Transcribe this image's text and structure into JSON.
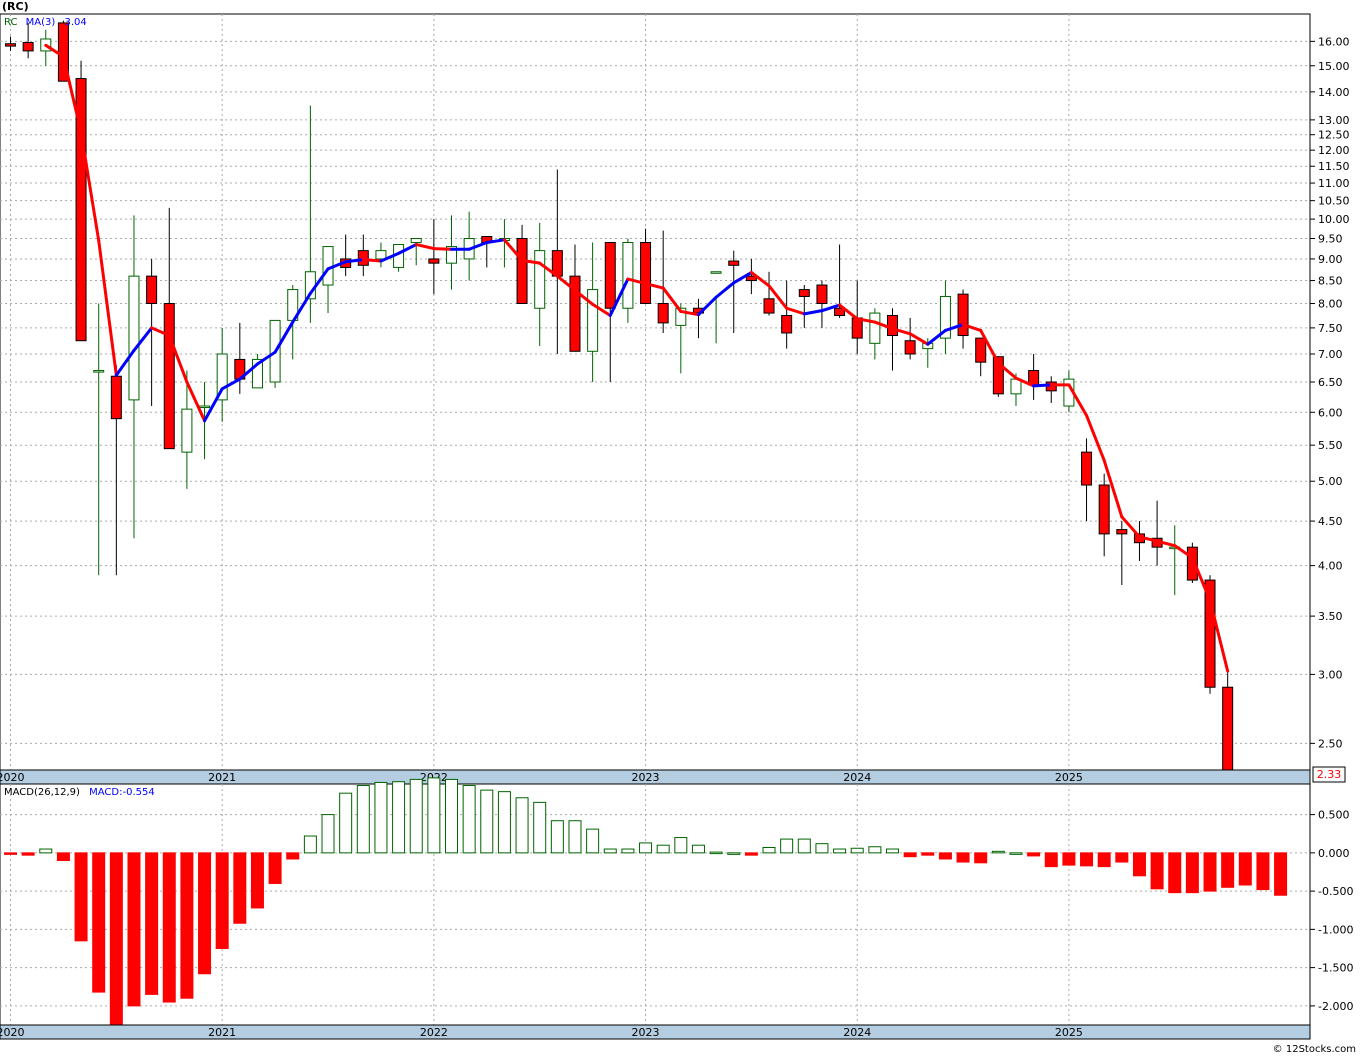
{
  "header": {
    "symbol_title": "(RC)",
    "price_legend_symbol": "RC",
    "price_legend_ma": "MA(3)",
    "price_legend_ma_value": "3.04",
    "macd_legend_name": "MACD(26,12,9)",
    "macd_legend_value": "MACD:-0.554",
    "last_price_badge": "2.33",
    "credit": "© 12Stocks.com"
  },
  "colors": {
    "up": "#006400",
    "down": "#ff0000",
    "ma_up": "#0000ff",
    "ma_down": "#ff0000",
    "axis_band": "#b4cde0",
    "grid": "#aaaaaa",
    "border": "#000000"
  },
  "chart_data": [
    {
      "type": "candlestick",
      "x_labels": [
        "2020",
        "2021",
        "2022",
        "2023",
        "2024",
        "2025"
      ],
      "y_scale": "log",
      "y_ticks": [
        "2.50",
        "3.00",
        "3.50",
        "4.00",
        "4.50",
        "5.00",
        "5.50",
        "6.00",
        "6.50",
        "7.00",
        "7.50",
        "8.00",
        "8.50",
        "9.00",
        "9.50",
        "10.00",
        "10.50",
        "11.00",
        "11.50",
        "12.00",
        "12.50",
        "13.00",
        "14.00",
        "15.00",
        "16.00"
      ],
      "ylim": [
        2.33,
        17.2
      ],
      "grid": true,
      "months": [
        "2020-01",
        "2020-02",
        "2020-03",
        "2020-04",
        "2020-05",
        "2020-06",
        "2020-07",
        "2020-08",
        "2020-09",
        "2020-10",
        "2020-11",
        "2020-12",
        "2021-01",
        "2021-02",
        "2021-03",
        "2021-04",
        "2021-05",
        "2021-06",
        "2021-07",
        "2021-08",
        "2021-09",
        "2021-10",
        "2021-11",
        "2021-12",
        "2022-01",
        "2022-02",
        "2022-03",
        "2022-04",
        "2022-05",
        "2022-06",
        "2022-07",
        "2022-08",
        "2022-09",
        "2022-10",
        "2022-11",
        "2022-12",
        "2023-01",
        "2023-02",
        "2023-03",
        "2023-04",
        "2023-05",
        "2023-06",
        "2023-07",
        "2023-08",
        "2023-09",
        "2023-10",
        "2023-11",
        "2023-12",
        "2024-01",
        "2024-02",
        "2024-03",
        "2024-04",
        "2024-05",
        "2024-06",
        "2024-07",
        "2024-08",
        "2024-09",
        "2024-10",
        "2024-11",
        "2024-12",
        "2025-01",
        "2025-02",
        "2025-03",
        "2025-04",
        "2025-05",
        "2025-06",
        "2025-07",
        "2025-08",
        "2025-09",
        "2025-10",
        "2025-11",
        "2025-12"
      ],
      "open": [
        15.9,
        15.95,
        15.6,
        16.8,
        14.5,
        6.7,
        6.6,
        6.2,
        8.6,
        8.0,
        5.4,
        6.1,
        6.2,
        6.9,
        6.4,
        6.5,
        7.65,
        8.1,
        8.4,
        9.0,
        9.2,
        9.0,
        8.8,
        9.4,
        9.0,
        8.9,
        9.0,
        9.55,
        9.45,
        9.5,
        7.9,
        9.2,
        8.6,
        7.05,
        9.4,
        7.9,
        9.4,
        8.0,
        7.55,
        7.9,
        8.7,
        8.95,
        8.6,
        8.1,
        7.75,
        8.3,
        8.4,
        7.9,
        7.7,
        7.2,
        7.75,
        7.25,
        7.1,
        7.3,
        8.2,
        7.3,
        6.95,
        6.3,
        6.7,
        6.5,
        6.1,
        5.4,
        4.95,
        4.4,
        4.35,
        4.3,
        4.2,
        4.2,
        3.85,
        2.9
      ],
      "high": [
        16.2,
        16.8,
        16.5,
        16.9,
        15.2,
        8.0,
        6.8,
        10.1,
        9.0,
        10.3,
        6.7,
        6.5,
        7.5,
        7.6,
        7.0,
        7.1,
        8.4,
        13.5,
        8.6,
        9.6,
        9.6,
        9.4,
        9.3,
        9.5,
        10.0,
        10.1,
        10.2,
        9.5,
        10.0,
        9.85,
        9.9,
        11.4,
        9.35,
        9.4,
        8.4,
        9.5,
        9.75,
        9.7,
        8.0,
        8.1,
        8.1,
        9.2,
        9.0,
        8.7,
        8.5,
        8.4,
        8.5,
        9.35,
        8.5,
        7.9,
        7.9,
        7.7,
        7.3,
        8.5,
        8.3,
        7.3,
        6.9,
        6.65,
        7.0,
        6.6,
        6.7,
        5.6,
        5.1,
        4.5,
        4.5,
        4.75,
        4.45,
        4.25,
        3.9,
        3.05
      ],
      "low": [
        15.6,
        15.3,
        15.0,
        15.5,
        14.3,
        3.9,
        3.9,
        4.3,
        6.1,
        6.0,
        4.9,
        5.3,
        5.85,
        6.3,
        6.4,
        6.4,
        6.9,
        7.6,
        7.8,
        8.6,
        8.6,
        8.8,
        8.7,
        8.85,
        8.2,
        8.3,
        8.5,
        8.8,
        8.8,
        8.3,
        7.15,
        7.0,
        8.4,
        6.5,
        6.5,
        7.6,
        8.0,
        7.4,
        6.65,
        7.3,
        7.2,
        7.4,
        8.2,
        7.75,
        7.1,
        7.5,
        7.5,
        7.7,
        7.0,
        6.9,
        6.7,
        6.9,
        6.75,
        7.0,
        7.1,
        6.6,
        6.25,
        6.1,
        6.2,
        6.15,
        6.0,
        4.5,
        4.1,
        3.8,
        4.05,
        4.0,
        3.7,
        3.82,
        2.85,
        2.33
      ],
      "close": [
        15.8,
        15.6,
        16.1,
        14.4,
        7.25,
        6.7,
        5.9,
        8.6,
        8.0,
        5.45,
        6.05,
        6.1,
        7.0,
        6.55,
        6.9,
        7.65,
        8.3,
        8.7,
        9.3,
        8.8,
        8.85,
        9.2,
        9.35,
        9.5,
        8.9,
        9.3,
        9.5,
        9.4,
        9.5,
        8.0,
        9.2,
        8.6,
        7.05,
        8.3,
        7.9,
        9.4,
        8.0,
        7.6,
        7.9,
        7.8,
        8.7,
        8.85,
        8.5,
        7.8,
        7.4,
        8.15,
        8.0,
        7.75,
        7.3,
        7.8,
        7.35,
        7.0,
        7.2,
        8.15,
        7.35,
        6.85,
        6.3,
        6.55,
        6.45,
        6.35,
        6.55,
        4.95,
        4.35,
        4.35,
        4.25,
        4.2,
        4.2,
        3.85,
        2.9,
        2.33
      ]
    },
    {
      "type": "bar",
      "name": "MACD(26,12,9)",
      "x_labels": [
        "2020",
        "2021",
        "2022",
        "2023",
        "2024",
        "2025"
      ],
      "y_ticks": [
        "-2.000",
        "-1.500",
        "-1.000",
        "-0.500",
        "0.000",
        "0.500"
      ],
      "ylim": [
        -2.25,
        0.9
      ],
      "values": [
        -0.02,
        -0.03,
        0.05,
        -0.1,
        -1.15,
        -1.82,
        -2.25,
        -2.0,
        -1.85,
        -1.95,
        -1.9,
        -1.58,
        -1.25,
        -0.92,
        -0.72,
        -0.4,
        -0.08,
        0.22,
        0.5,
        0.78,
        0.88,
        0.92,
        0.93,
        0.96,
        0.98,
        0.96,
        0.88,
        0.82,
        0.8,
        0.72,
        0.66,
        0.42,
        0.42,
        0.31,
        0.05,
        0.05,
        0.13,
        0.1,
        0.2,
        0.1,
        0.01,
        0.0,
        -0.03,
        0.07,
        0.18,
        0.18,
        0.12,
        0.05,
        0.06,
        0.08,
        0.05,
        -0.05,
        -0.03,
        -0.08,
        -0.12,
        -0.13,
        0.02,
        0.0,
        -0.04,
        -0.18,
        -0.16,
        -0.17,
        -0.18,
        -0.12,
        -0.3,
        -0.47,
        -0.52,
        -0.52,
        -0.5,
        -0.45,
        -0.42,
        -0.48,
        -0.554
      ]
    }
  ]
}
